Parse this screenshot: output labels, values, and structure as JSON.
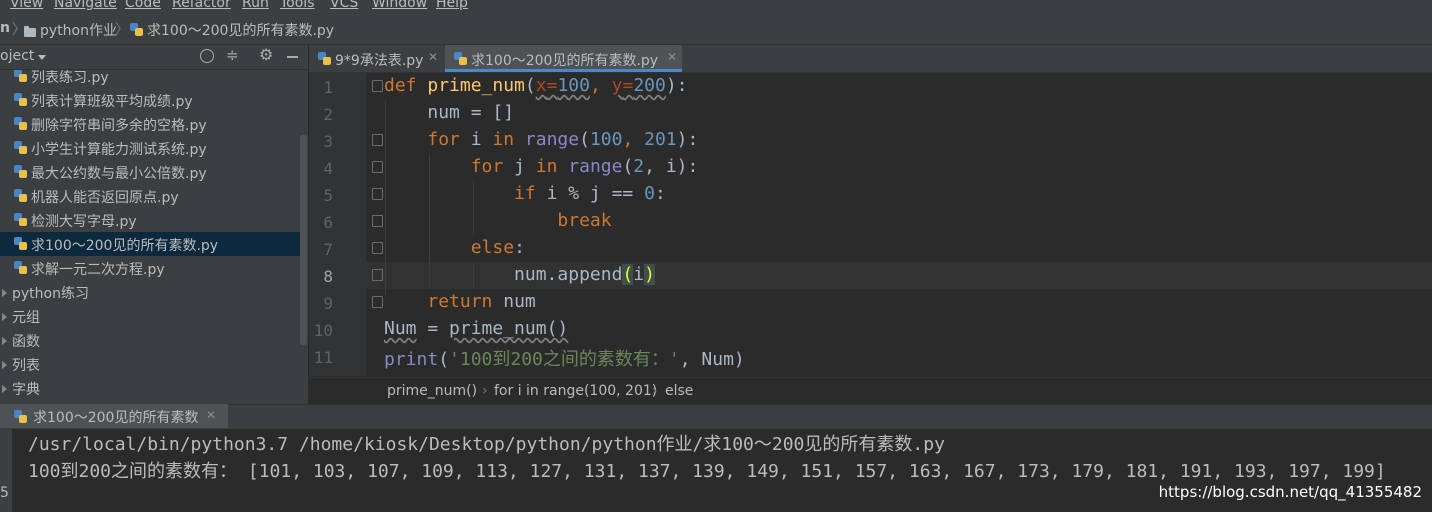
{
  "menu": [
    "View",
    "Navigate",
    "Code",
    "Refactor",
    "Run",
    "Tools",
    "VCS",
    "Window",
    "Help"
  ],
  "navbar": {
    "project_fragment": "n",
    "folder": "python作业",
    "file": "求100～200见的所有素数.py"
  },
  "project_panel": {
    "title": "oject",
    "files": [
      "列表练习.py",
      "列表计算班级平均成绩.py",
      "删除字符串间多余的空格.py",
      "小学生计算能力测试系统.py",
      "最大公约数与最小公倍数.py",
      "机器人能否返回原点.py",
      "检测大写字母.py",
      "求100～200见的所有素数.py",
      "求解一元二次方程.py"
    ],
    "selected_index": 7,
    "folders": [
      "python练习",
      "元组",
      "函数",
      "列表",
      "字典"
    ]
  },
  "tabs": [
    {
      "label": "9*9承法表.py",
      "active": false
    },
    {
      "label": "求100～200见的所有素数.py",
      "active": true
    }
  ],
  "code": {
    "line_numbers": [
      "1",
      "2",
      "3",
      "4",
      "5",
      "6",
      "7",
      "8",
      "9",
      "10",
      "11"
    ],
    "current_line": 8,
    "l1": {
      "kw": "def",
      "name": "prime_num",
      "open": "(",
      "p1": "x",
      "eq1": "=",
      "v1": "100",
      "comma": ", ",
      "p2": "y",
      "eq2": "=",
      "v2": "200",
      "close": "):"
    },
    "l2": {
      "text": "num = []"
    },
    "l3": {
      "kw1": "for",
      "var": " i ",
      "kw2": "in",
      "sp": " ",
      "fn": "range",
      "open": "(",
      "a": "100",
      "comma": ", ",
      "b": "201",
      "close": "):"
    },
    "l4": {
      "kw1": "for",
      "var": " j ",
      "kw2": "in",
      "sp": " ",
      "fn": "range",
      "open": "(",
      "a": "2",
      "rest": ", i):"
    },
    "l5": {
      "kw": "if",
      "mid": " i % j == ",
      "zero": "0",
      "colon": ":"
    },
    "l6": {
      "kw": "break"
    },
    "l7": {
      "kw": "else",
      "colon": ":"
    },
    "l8": {
      "pre": "num.append",
      "open": "(",
      "arg": "i",
      "close": ")"
    },
    "l9": {
      "kw": "return",
      "rest": " num"
    },
    "l10": {
      "lhs": "Num",
      "mid": " = ",
      "call": "prime_num()"
    },
    "l11": {
      "fn": "print",
      "open": "(",
      "str": "'100到200之间的素数有：'",
      "rest": ", Num)"
    }
  },
  "editor_breadcrumb": [
    "prime_num()",
    "for i in range(100, 201)",
    "else"
  ],
  "run": {
    "tab_label": "求100～200见的所有素数",
    "output": [
      "/usr/local/bin/python3.7 /home/kiosk/Desktop/python/python作业/求100～200见的所有素数.py",
      "100到200之间的素数有： [101, 103, 107, 109, 113, 127, 131, 137, 139, 149, 151, 157, 163, 167, 173, 179, 181, 191, 193, 197, 199]"
    ],
    "gutter_fragment": "5"
  },
  "watermark": "https://blog.csdn.net/qq_41355482",
  "colors": {
    "keyword": "#cc7832",
    "function": "#ffc66d",
    "number": "#6897bb",
    "builtin": "#8888c6",
    "string": "#6a8759",
    "selection": "#0d293e"
  }
}
